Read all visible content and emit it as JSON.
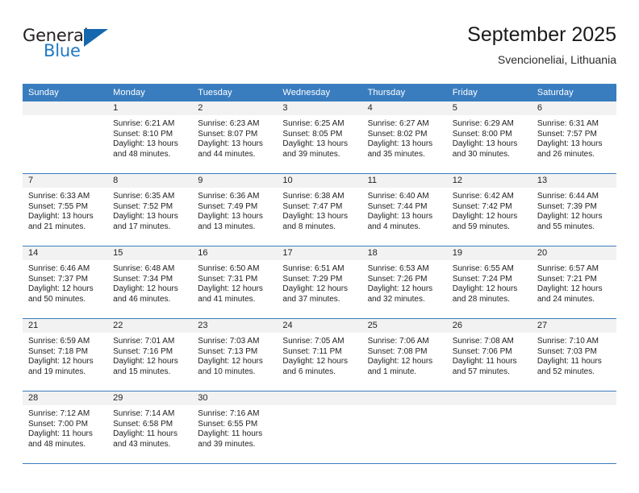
{
  "brand": {
    "name_top": "General",
    "name_bottom": "Blue",
    "accent_color": "#1567ae"
  },
  "header": {
    "title": "September 2025",
    "subtitle": "Svencioneliai, Lithuania",
    "header_bg": "#3a7dbf",
    "header_text": "#ffffff",
    "daynum_bg": "#f2f2f2"
  },
  "weekday_headers": [
    "Sunday",
    "Monday",
    "Tuesday",
    "Wednesday",
    "Thursday",
    "Friday",
    "Saturday"
  ],
  "weeks": [
    [
      {
        "day": "",
        "sunrise": "",
        "sunset": "",
        "daylight1": "",
        "daylight2": ""
      },
      {
        "day": "1",
        "sunrise": "Sunrise: 6:21 AM",
        "sunset": "Sunset: 8:10 PM",
        "daylight1": "Daylight: 13 hours",
        "daylight2": "and 48 minutes."
      },
      {
        "day": "2",
        "sunrise": "Sunrise: 6:23 AM",
        "sunset": "Sunset: 8:07 PM",
        "daylight1": "Daylight: 13 hours",
        "daylight2": "and 44 minutes."
      },
      {
        "day": "3",
        "sunrise": "Sunrise: 6:25 AM",
        "sunset": "Sunset: 8:05 PM",
        "daylight1": "Daylight: 13 hours",
        "daylight2": "and 39 minutes."
      },
      {
        "day": "4",
        "sunrise": "Sunrise: 6:27 AM",
        "sunset": "Sunset: 8:02 PM",
        "daylight1": "Daylight: 13 hours",
        "daylight2": "and 35 minutes."
      },
      {
        "day": "5",
        "sunrise": "Sunrise: 6:29 AM",
        "sunset": "Sunset: 8:00 PM",
        "daylight1": "Daylight: 13 hours",
        "daylight2": "and 30 minutes."
      },
      {
        "day": "6",
        "sunrise": "Sunrise: 6:31 AM",
        "sunset": "Sunset: 7:57 PM",
        "daylight1": "Daylight: 13 hours",
        "daylight2": "and 26 minutes."
      }
    ],
    [
      {
        "day": "7",
        "sunrise": "Sunrise: 6:33 AM",
        "sunset": "Sunset: 7:55 PM",
        "daylight1": "Daylight: 13 hours",
        "daylight2": "and 21 minutes."
      },
      {
        "day": "8",
        "sunrise": "Sunrise: 6:35 AM",
        "sunset": "Sunset: 7:52 PM",
        "daylight1": "Daylight: 13 hours",
        "daylight2": "and 17 minutes."
      },
      {
        "day": "9",
        "sunrise": "Sunrise: 6:36 AM",
        "sunset": "Sunset: 7:49 PM",
        "daylight1": "Daylight: 13 hours",
        "daylight2": "and 13 minutes."
      },
      {
        "day": "10",
        "sunrise": "Sunrise: 6:38 AM",
        "sunset": "Sunset: 7:47 PM",
        "daylight1": "Daylight: 13 hours",
        "daylight2": "and 8 minutes."
      },
      {
        "day": "11",
        "sunrise": "Sunrise: 6:40 AM",
        "sunset": "Sunset: 7:44 PM",
        "daylight1": "Daylight: 13 hours",
        "daylight2": "and 4 minutes."
      },
      {
        "day": "12",
        "sunrise": "Sunrise: 6:42 AM",
        "sunset": "Sunset: 7:42 PM",
        "daylight1": "Daylight: 12 hours",
        "daylight2": "and 59 minutes."
      },
      {
        "day": "13",
        "sunrise": "Sunrise: 6:44 AM",
        "sunset": "Sunset: 7:39 PM",
        "daylight1": "Daylight: 12 hours",
        "daylight2": "and 55 minutes."
      }
    ],
    [
      {
        "day": "14",
        "sunrise": "Sunrise: 6:46 AM",
        "sunset": "Sunset: 7:37 PM",
        "daylight1": "Daylight: 12 hours",
        "daylight2": "and 50 minutes."
      },
      {
        "day": "15",
        "sunrise": "Sunrise: 6:48 AM",
        "sunset": "Sunset: 7:34 PM",
        "daylight1": "Daylight: 12 hours",
        "daylight2": "and 46 minutes."
      },
      {
        "day": "16",
        "sunrise": "Sunrise: 6:50 AM",
        "sunset": "Sunset: 7:31 PM",
        "daylight1": "Daylight: 12 hours",
        "daylight2": "and 41 minutes."
      },
      {
        "day": "17",
        "sunrise": "Sunrise: 6:51 AM",
        "sunset": "Sunset: 7:29 PM",
        "daylight1": "Daylight: 12 hours",
        "daylight2": "and 37 minutes."
      },
      {
        "day": "18",
        "sunrise": "Sunrise: 6:53 AM",
        "sunset": "Sunset: 7:26 PM",
        "daylight1": "Daylight: 12 hours",
        "daylight2": "and 32 minutes."
      },
      {
        "day": "19",
        "sunrise": "Sunrise: 6:55 AM",
        "sunset": "Sunset: 7:24 PM",
        "daylight1": "Daylight: 12 hours",
        "daylight2": "and 28 minutes."
      },
      {
        "day": "20",
        "sunrise": "Sunrise: 6:57 AM",
        "sunset": "Sunset: 7:21 PM",
        "daylight1": "Daylight: 12 hours",
        "daylight2": "and 24 minutes."
      }
    ],
    [
      {
        "day": "21",
        "sunrise": "Sunrise: 6:59 AM",
        "sunset": "Sunset: 7:18 PM",
        "daylight1": "Daylight: 12 hours",
        "daylight2": "and 19 minutes."
      },
      {
        "day": "22",
        "sunrise": "Sunrise: 7:01 AM",
        "sunset": "Sunset: 7:16 PM",
        "daylight1": "Daylight: 12 hours",
        "daylight2": "and 15 minutes."
      },
      {
        "day": "23",
        "sunrise": "Sunrise: 7:03 AM",
        "sunset": "Sunset: 7:13 PM",
        "daylight1": "Daylight: 12 hours",
        "daylight2": "and 10 minutes."
      },
      {
        "day": "24",
        "sunrise": "Sunrise: 7:05 AM",
        "sunset": "Sunset: 7:11 PM",
        "daylight1": "Daylight: 12 hours",
        "daylight2": "and 6 minutes."
      },
      {
        "day": "25",
        "sunrise": "Sunrise: 7:06 AM",
        "sunset": "Sunset: 7:08 PM",
        "daylight1": "Daylight: 12 hours",
        "daylight2": "and 1 minute."
      },
      {
        "day": "26",
        "sunrise": "Sunrise: 7:08 AM",
        "sunset": "Sunset: 7:06 PM",
        "daylight1": "Daylight: 11 hours",
        "daylight2": "and 57 minutes."
      },
      {
        "day": "27",
        "sunrise": "Sunrise: 7:10 AM",
        "sunset": "Sunset: 7:03 PM",
        "daylight1": "Daylight: 11 hours",
        "daylight2": "and 52 minutes."
      }
    ],
    [
      {
        "day": "28",
        "sunrise": "Sunrise: 7:12 AM",
        "sunset": "Sunset: 7:00 PM",
        "daylight1": "Daylight: 11 hours",
        "daylight2": "and 48 minutes."
      },
      {
        "day": "29",
        "sunrise": "Sunrise: 7:14 AM",
        "sunset": "Sunset: 6:58 PM",
        "daylight1": "Daylight: 11 hours",
        "daylight2": "and 43 minutes."
      },
      {
        "day": "30",
        "sunrise": "Sunrise: 7:16 AM",
        "sunset": "Sunset: 6:55 PM",
        "daylight1": "Daylight: 11 hours",
        "daylight2": "and 39 minutes."
      },
      {
        "day": "",
        "sunrise": "",
        "sunset": "",
        "daylight1": "",
        "daylight2": ""
      },
      {
        "day": "",
        "sunrise": "",
        "sunset": "",
        "daylight1": "",
        "daylight2": ""
      },
      {
        "day": "",
        "sunrise": "",
        "sunset": "",
        "daylight1": "",
        "daylight2": ""
      },
      {
        "day": "",
        "sunrise": "",
        "sunset": "",
        "daylight1": "",
        "daylight2": ""
      }
    ]
  ]
}
